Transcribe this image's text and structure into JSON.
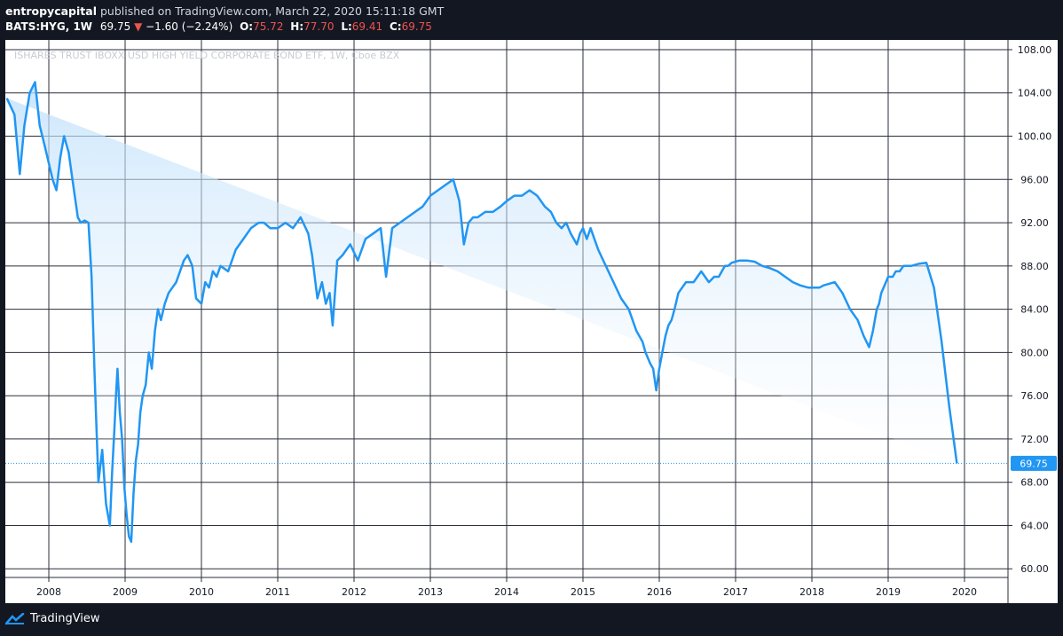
{
  "header": {
    "author": "entropycapital",
    "published_text": " published on TradingView.com, March 22, 2020 15:11:18 GMT"
  },
  "quote": {
    "symbol": "BATS:HYG, 1W",
    "last": "69.75",
    "down_arrow": "▼",
    "change": "−1.60 (−2.24%)",
    "o_label": "O:",
    "o_value": "75.72",
    "h_label": "H:",
    "h_value": "77.70",
    "l_label": "L:",
    "l_value": "69.41",
    "c_label": "C:",
    "c_value": "69.75"
  },
  "footer": {
    "brand": "TradingView"
  },
  "colors": {
    "line": "#2196f3",
    "area_top": "#bbdefb",
    "grid": "#2a2e39",
    "price_tag": "#2196f3",
    "down": "#ef5350"
  },
  "chart_data": {
    "type": "area",
    "watermark": "ISHARES TRUST IBOXX USD HIGH YIELD CORPORATE BOND ETF, 1W, Cboe BZX",
    "x_tick_labels": [
      "2008",
      "2009",
      "2010",
      "2011",
      "2012",
      "2013",
      "2014",
      "2015",
      "2016",
      "2017",
      "2018",
      "2019",
      "2020"
    ],
    "y_tick_labels": [
      "108.00",
      "104.00",
      "100.00",
      "96.00",
      "92.00",
      "88.00",
      "84.00",
      "80.00",
      "76.00",
      "72.00",
      "68.00",
      "64.00",
      "60.00"
    ],
    "y_ticks": [
      108,
      104,
      100,
      96,
      92,
      88,
      84,
      80,
      76,
      72,
      68,
      64,
      60
    ],
    "ylim": [
      59.2,
      108.9
    ],
    "xlim": [
      2007.43,
      2020.57
    ],
    "last_price_label": "69.75",
    "last_price": 69.75,
    "grid": true,
    "x": [
      2007.45,
      2007.55,
      2007.62,
      2007.68,
      2007.75,
      2007.82,
      2007.88,
      2007.95,
      2008.0,
      2008.05,
      2008.1,
      2008.15,
      2008.2,
      2008.26,
      2008.32,
      2008.38,
      2008.42,
      2008.47,
      2008.52,
      2008.56,
      2008.6,
      2008.65,
      2008.7,
      2008.75,
      2008.8,
      2008.83,
      2008.86,
      2008.88,
      2008.9,
      2008.93,
      2008.96,
      2008.99,
      2009.02,
      2009.05,
      2009.08,
      2009.11,
      2009.14,
      2009.17,
      2009.2,
      2009.23,
      2009.27,
      2009.31,
      2009.35,
      2009.39,
      2009.43,
      2009.47,
      2009.52,
      2009.57,
      2009.62,
      2009.67,
      2009.72,
      2009.77,
      2009.82,
      2009.88,
      2009.93,
      2010.0,
      2010.05,
      2010.1,
      2010.15,
      2010.2,
      2010.25,
      2010.35,
      2010.45,
      2010.55,
      2010.65,
      2010.75,
      2010.82,
      2010.9,
      2011.0,
      2011.1,
      2011.2,
      2011.3,
      2011.4,
      2011.45,
      2011.52,
      2011.58,
      2011.63,
      2011.68,
      2011.72,
      2011.78,
      2011.85,
      2011.95,
      2012.05,
      2012.15,
      2012.25,
      2012.35,
      2012.42,
      2012.5,
      2012.6,
      2012.7,
      2012.8,
      2012.9,
      2013.0,
      2013.1,
      2013.2,
      2013.3,
      2013.38,
      2013.44,
      2013.5,
      2013.56,
      2013.62,
      2013.72,
      2013.82,
      2013.92,
      2014.0,
      2014.1,
      2014.2,
      2014.3,
      2014.4,
      2014.5,
      2014.58,
      2014.65,
      2014.72,
      2014.78,
      2014.84,
      2014.88,
      2014.92,
      2014.96,
      2015.0,
      2015.05,
      2015.1,
      2015.15,
      2015.2,
      2015.3,
      2015.4,
      2015.5,
      2015.6,
      2015.7,
      2015.78,
      2015.82,
      2015.88,
      2015.92,
      2015.96,
      2016.0,
      2016.04,
      2016.08,
      2016.12,
      2016.16,
      2016.2,
      2016.25,
      2016.3,
      2016.35,
      2016.4,
      2016.45,
      2016.5,
      2016.55,
      2016.6,
      2016.65,
      2016.72,
      2016.78,
      2016.82,
      2016.86,
      2016.9,
      2016.95,
      2017.05,
      2017.15,
      2017.25,
      2017.35,
      2017.45,
      2017.55,
      2017.65,
      2017.75,
      2017.85,
      2017.95,
      2018.05,
      2018.1,
      2018.15,
      2018.2,
      2018.3,
      2018.4,
      2018.5,
      2018.6,
      2018.68,
      2018.75,
      2018.8,
      2018.85,
      2018.88,
      2018.91,
      2018.94,
      2018.97,
      2019.0,
      2019.03,
      2019.06,
      2019.1,
      2019.15,
      2019.2,
      2019.3,
      2019.4,
      2019.5,
      2019.6,
      2019.7,
      2019.8,
      2019.9,
      2020.0,
      2020.05,
      2020.08,
      2020.11,
      2020.14,
      2020.16,
      2020.18,
      2020.2
    ],
    "y": [
      103.5,
      102.0,
      96.5,
      101.0,
      104.0,
      105.0,
      101.0,
      99.0,
      97.5,
      96.0,
      95.0,
      98.0,
      100.0,
      98.5,
      95.5,
      92.5,
      92.0,
      92.2,
      92.0,
      87.0,
      78.0,
      68.0,
      71.0,
      66.0,
      64.0,
      69.0,
      73.0,
      76.0,
      78.5,
      74.5,
      72.0,
      67.5,
      65.0,
      63.0,
      62.5,
      67.0,
      70.0,
      71.5,
      74.5,
      76.0,
      77.0,
      80.0,
      78.5,
      82.0,
      84.0,
      83.0,
      84.5,
      85.5,
      86.0,
      86.5,
      87.5,
      88.5,
      89.0,
      88.0,
      85.0,
      84.5,
      86.5,
      86.0,
      87.5,
      87.0,
      88.0,
      87.5,
      89.5,
      90.5,
      91.5,
      92.0,
      92.0,
      91.5,
      91.5,
      92.0,
      91.5,
      92.5,
      91.0,
      89.0,
      85.0,
      86.5,
      84.5,
      85.5,
      82.5,
      88.5,
      89.0,
      90.0,
      88.5,
      90.5,
      91.0,
      91.5,
      87.0,
      91.5,
      92.0,
      92.5,
      93.0,
      93.5,
      94.5,
      95.0,
      95.5,
      96.0,
      94.0,
      90.0,
      92.0,
      92.5,
      92.5,
      93.0,
      93.0,
      93.5,
      94.0,
      94.5,
      94.5,
      95.0,
      94.5,
      93.5,
      93.0,
      92.0,
      91.5,
      92.0,
      91.0,
      90.5,
      90.0,
      91.0,
      91.5,
      90.5,
      91.5,
      90.5,
      89.5,
      88.0,
      86.5,
      85.0,
      84.0,
      82.0,
      81.0,
      80.0,
      79.0,
      78.5,
      76.5,
      78.5,
      80.0,
      81.5,
      82.5,
      83.0,
      84.0,
      85.5,
      86.0,
      86.5,
      86.5,
      86.5,
      87.0,
      87.5,
      87.0,
      86.5,
      87.0,
      87.0,
      87.5,
      88.0,
      88.0,
      88.3,
      88.5,
      88.5,
      88.4,
      88.0,
      87.8,
      87.5,
      87.0,
      86.5,
      86.2,
      86.0,
      86.0,
      86.0,
      86.2,
      86.3,
      86.5,
      85.5,
      84.0,
      83.0,
      81.5,
      80.5,
      82.0,
      84.0,
      84.5,
      85.5,
      86.0,
      86.5,
      87.0,
      87.0,
      87.0,
      87.5,
      87.5,
      88.0,
      88.0,
      88.2,
      88.3,
      86.0,
      81.0,
      75.0,
      69.75
    ]
  }
}
